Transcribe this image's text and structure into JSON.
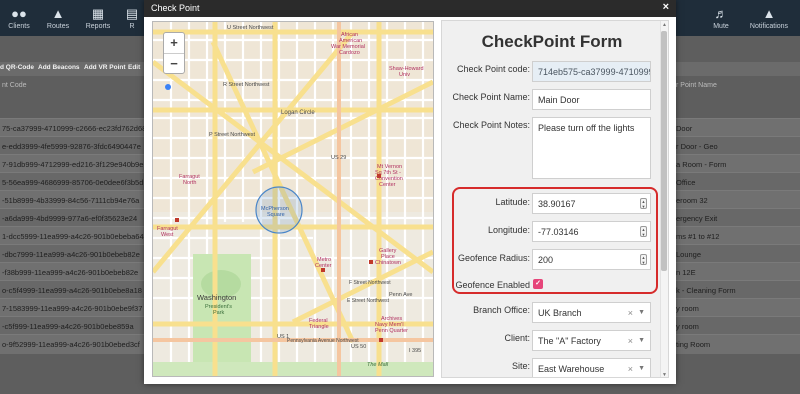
{
  "topnav": {
    "left_items": [
      {
        "label": "Clients",
        "icon": "users-icon"
      },
      {
        "label": "Routes",
        "icon": "road-icon"
      },
      {
        "label": "Reports",
        "icon": "bar-chart-icon"
      },
      {
        "label": "R",
        "icon": "grid-icon"
      }
    ],
    "right_items": [
      {
        "label": "Mute",
        "icon": "volume-icon"
      },
      {
        "label": "Notifications",
        "icon": "bell-icon"
      }
    ]
  },
  "toolbar": {
    "items": [
      "d QR-Code",
      "Add Beacons",
      "Add VR Point",
      "Edit"
    ]
  },
  "table": {
    "left_header": "nt Code",
    "right_header": "r Point Name",
    "rows": [
      {
        "code": "75-ca37999-4710999-c2666-ec23fd762d68",
        "name": "Door"
      },
      {
        "code": "e-edd3999-4fe5999-92876-3fdc6490447e",
        "name": "r Door - Geo"
      },
      {
        "code": "7-91db999-4712999-ed216-3f129e940b9e",
        "name": "a Room - Form"
      },
      {
        "code": "5-56ea999-4686999-85706-0e0dee6f3b5d",
        "name": "Office"
      },
      {
        "code": "-51b8999-4b33999-84c56-7111cb94e76a",
        "name": "eroom 32"
      },
      {
        "code": "-a6da999-4bd9999-977a6-ef0f35623e24",
        "name": "ergency Exit"
      },
      {
        "code": "1-dcc5999-11ea999-a4c26-901b0ebeba64",
        "name": "ms #1 to #12"
      },
      {
        "code": "-dbc7999-11ea999-a4c26-901b0ebeb82e",
        "name": "Lounge"
      },
      {
        "code": "-f38b999-11ea999-a4c26-901b0ebeb82e",
        "name": "n 12E"
      },
      {
        "code": "o-c5f4999-11ea999-a4c26-901b0ebe8a18",
        "name": "k - Cleaning Form"
      },
      {
        "code": "7-1583999-11ea999-a4c26-901b0ebe9f37",
        "name": "y room"
      },
      {
        "code": "-c5f999-11ea999-a4c26-901b0ebe859a",
        "name": "y room"
      },
      {
        "code": "o-9f52999-11ea999-a4c26-901b0ebed3cf",
        "name": "ting Room"
      }
    ]
  },
  "modal": {
    "title": "Check Point",
    "close_label": "×",
    "form": {
      "title": "CheckPoint Form",
      "fields": {
        "code": {
          "label": "Check Point code:",
          "value": "714eb575-ca37999-4710999-c2666-ec23fd762d68"
        },
        "name": {
          "label": "Check Point Name:",
          "value": "Main Door"
        },
        "notes": {
          "label": "Check Point Notes:",
          "value": "Please turn off the lights"
        },
        "latitude": {
          "label": "Latitude:",
          "value": "38.90167"
        },
        "longitude": {
          "label": "Longitude:",
          "value": "-77.03146"
        },
        "radius": {
          "label": "Geofence Radius:",
          "value": "200"
        },
        "geofence_enabled": {
          "label": "Geofence Enabled",
          "checked": true
        },
        "branch": {
          "label": "Branch Office:",
          "value": "UK Branch"
        },
        "client": {
          "label": "Client:",
          "value": "The \"A\" Factory"
        },
        "site": {
          "label": "Site:",
          "value": "East Warehouse"
        }
      }
    },
    "map": {
      "labels": {
        "u_street": "U Street Northwest",
        "african_american": "African",
        "african_american2": "American",
        "african_american3": "War Memorial",
        "cardozo": "Cardozo",
        "shaw": "Shaw-Howard",
        "shaw2": "Univ",
        "r_street": "R Street Northwest",
        "logan": "Logan Circle",
        "p_street": "P Street Northwest",
        "us29": "US 29",
        "mt_vernon": "Mt Vernon",
        "mt_vernon2": "Sq 7th St -",
        "mt_vernon3": "Convention",
        "mt_vernon4": "Center",
        "farragut_n": "Farragut",
        "farragut_n2": "North",
        "mcpherson": "McPherson",
        "mcpherson2": "Square",
        "metro": "Metro",
        "metro2": "Center",
        "gallery": "Gallery",
        "gallery2": "Place",
        "gallery3": "Chinatown",
        "farragut_w": "Farragut",
        "farragut_w2": "West",
        "washington": "Washington",
        "presidents": "President's",
        "park": "Park",
        "federal": "Federal",
        "federal2": "Triangle",
        "archives": "Archives",
        "archives2": "Navy Mem'l",
        "archives3": "Penn Quarter",
        "penn_ave": "Penn Ave",
        "mall": "The Mall",
        "pennsylvania": "Pennsylvania Avenue Northwest",
        "e_street": "E Street Northwest",
        "f_street": "F Street Northwest",
        "us1": "US 1",
        "us50": "US 50",
        "i395": "I 395"
      },
      "zoom_in": "+",
      "zoom_out": "−"
    }
  },
  "colors": {
    "modal_header": "#2b2b2b",
    "highlight_border": "#d62b2b",
    "checkbox": "#e6457a",
    "map_bg": "#efe9dd",
    "major_road": "#f8e08e",
    "geofence": "#4a86c8"
  }
}
